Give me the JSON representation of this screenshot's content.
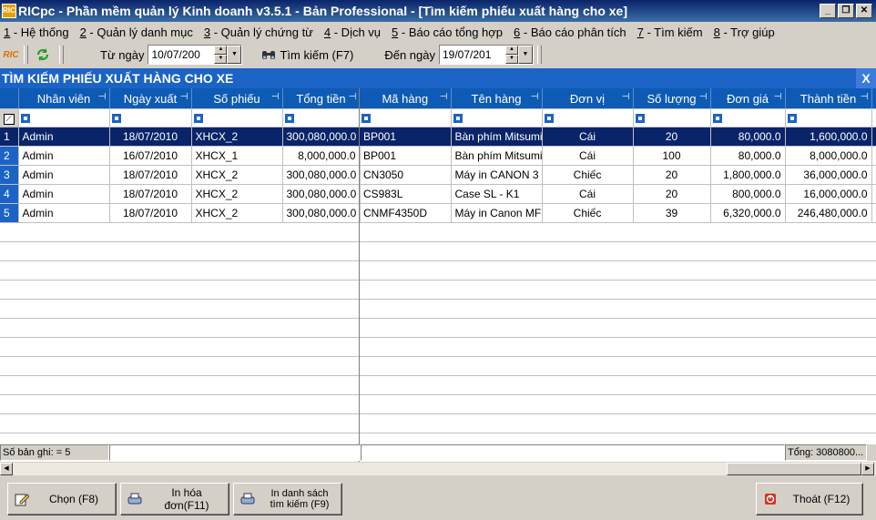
{
  "window": {
    "title": "RICpc - Phần mềm quản lý Kinh doanh v3.5.1 - Bản Professional - [Tìm kiếm phiếu xuất hàng cho xe]",
    "icon_text": "RIC"
  },
  "menu": [
    {
      "num": "1",
      "label": " - Hệ thống"
    },
    {
      "num": "2",
      "label": " - Quản lý danh mục"
    },
    {
      "num": "3",
      "label": " - Quản lý chứng từ"
    },
    {
      "num": "4",
      "label": " - Dịch vụ"
    },
    {
      "num": "5",
      "label": " - Báo cáo tổng hợp"
    },
    {
      "num": "6",
      "label": " - Báo cáo phân tích"
    },
    {
      "num": "7",
      "label": " - Tìm kiếm"
    },
    {
      "num": "8",
      "label": " - Trợ giúp"
    }
  ],
  "toolbar": {
    "from_label": "Từ ngày",
    "from_value": "10/07/200",
    "search_label": "Tìm kiếm (F7)",
    "to_label": "Đến ngày",
    "to_value": "19/07/201"
  },
  "panel": {
    "title": "TÌM KIẾM PHIẾU XUẤT HÀNG CHO XE",
    "close": "X"
  },
  "left_grid": {
    "headers": [
      "Nhân viên",
      "Ngày xuất",
      "Số phiếu",
      "Tổng tiền"
    ],
    "rows": [
      {
        "n": "1",
        "cells": [
          "Admin",
          "18/07/2010",
          "XHCX_2",
          "300,080,000.0"
        ]
      },
      {
        "n": "2",
        "cells": [
          "Admin",
          "16/07/2010",
          "XHCX_1",
          "8,000,000.0"
        ]
      },
      {
        "n": "3",
        "cells": [
          "Admin",
          "18/07/2010",
          "XHCX_2",
          "300,080,000.0"
        ]
      },
      {
        "n": "4",
        "cells": [
          "Admin",
          "18/07/2010",
          "XHCX_2",
          "300,080,000.0"
        ]
      },
      {
        "n": "5",
        "cells": [
          "Admin",
          "18/07/2010",
          "XHCX_2",
          "300,080,000.0"
        ]
      }
    ]
  },
  "right_grid": {
    "headers": [
      "Mã hàng",
      "Tên hàng",
      "Đơn vị",
      "Số lượng",
      "Đơn giá",
      "Thành tiền"
    ],
    "rows": [
      [
        "BP001",
        "Bàn phím Mitsumi",
        "Cái",
        "20",
        "80,000.0",
        "1,600,000.0"
      ],
      [
        "BP001",
        "Bàn phím Mitsumi",
        "Cái",
        "100",
        "80,000.0",
        "8,000,000.0"
      ],
      [
        "CN3050",
        "Máy in CANON 3",
        "Chiếc",
        "20",
        "1,800,000.0",
        "36,000,000.0"
      ],
      [
        "CS983L",
        "Case SL - K1",
        "Cái",
        "20",
        "800,000.0",
        "16,000,000.0"
      ],
      [
        "CNMF4350D",
        "Máy in Canon MF",
        "Chiếc",
        "39",
        "6,320,000.0",
        "246,480,000.0"
      ]
    ]
  },
  "footer": {
    "record_count": "Số bản ghi: = 5",
    "total": "Tổng:  3080800..."
  },
  "buttons": {
    "choose": "Chọn (F8)",
    "print_invoice": "In hóa đơn(F11)",
    "print_list": "In danh sách tìm kiếm (F9)",
    "exit": "Thoát (F12)"
  }
}
